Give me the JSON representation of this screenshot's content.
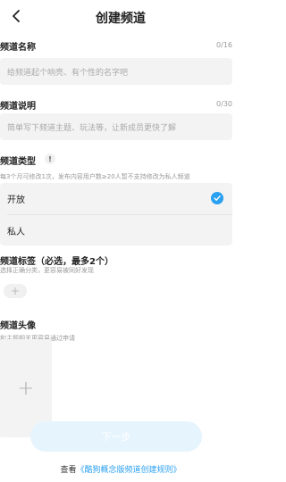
{
  "header": {
    "title": "创建频道",
    "back_icon": "chevron-left-icon"
  },
  "name": {
    "label": "频道名称",
    "counter": "0/16",
    "placeholder": "给频道起个响亮、有个性的名字吧"
  },
  "description": {
    "label": "频道说明",
    "counter": "0/30",
    "placeholder": "简单写下频道主题、玩法等，让新成员更快了解"
  },
  "type": {
    "label": "频道类型",
    "info_glyph": "!",
    "hint": "每3个月可修改1次，发布内容用户数≥20人暂不支持修改为私人频道",
    "options": [
      {
        "label": "开放",
        "selected": true
      },
      {
        "label": "私人",
        "selected": false
      }
    ],
    "accent": "#2aa0f0"
  },
  "tags": {
    "label": "频道标签（必选，最多2个）",
    "hint": "选择正确分类，更容易被同好发现",
    "add_glyph": "+"
  },
  "avatar": {
    "label": "频道头像",
    "hint": "和主题相关更容易通过申请",
    "add_glyph": "+"
  },
  "next_button": {
    "label": "下一步"
  },
  "footer": {
    "prefix": "查看",
    "link": "《酷狗概念版频道创建规则》"
  }
}
